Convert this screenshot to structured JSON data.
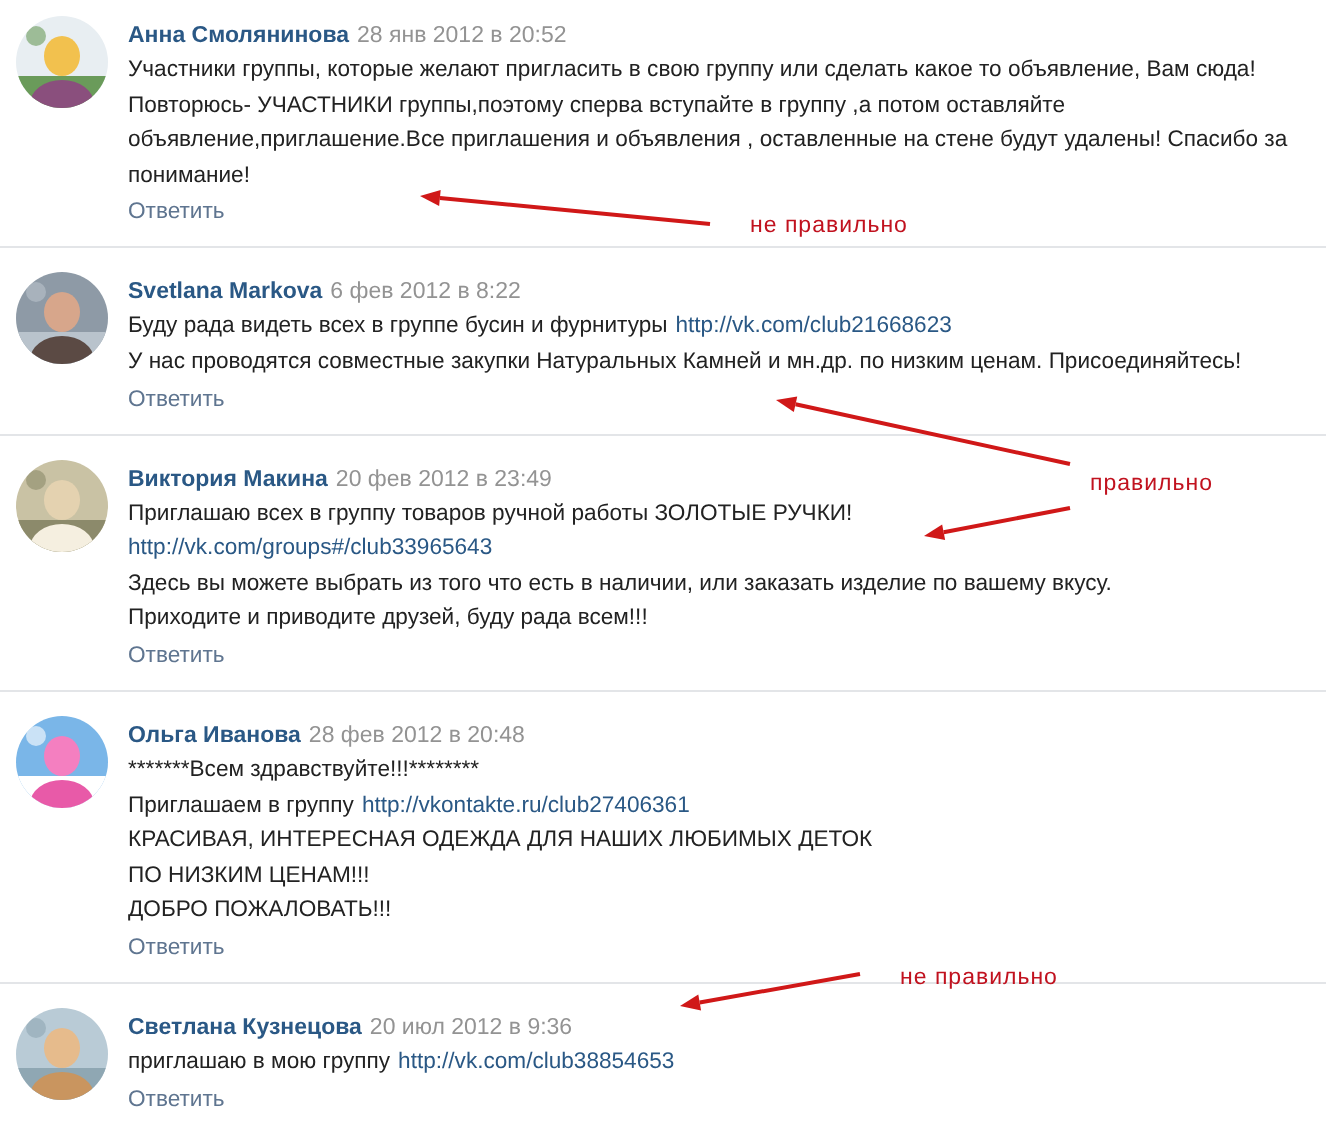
{
  "comments": [
    {
      "author": "Анна Смолянинова",
      "date": "28 янв 2012 в 20:52",
      "avatar": {
        "kind": "picture"
      },
      "lines": [
        [
          {
            "text": "Участники группы, которые желают пригласить в свою группу или сделать какое то объявление, Вам сюда!"
          }
        ],
        [
          {
            "text": "Повторюсь- УЧАСТНИКИ группы,поэтому сперва вступайте в группу ,а потом оставляйте"
          }
        ],
        [
          {
            "text": "объявление,приглашение.Все приглашения и объявления , оставленные на стене будут удалены! Спасибо за"
          }
        ],
        [
          {
            "text": "понимание!"
          }
        ]
      ],
      "reply": "Ответить"
    },
    {
      "author": "Svetlana Markova",
      "date": "6 фев 2012 в 8:22",
      "avatar": {
        "kind": "picture"
      },
      "lines": [
        [
          {
            "text": "Буду рада видеть всех в группе бусин и фурнитуры"
          },
          {
            "text": "http://vk.com/club21668623",
            "link": true
          }
        ],
        [
          {
            "text": "У нас проводятся совместные закупки Натуральных Камней и мн.др. по низким ценам. Присоединяйтесь!"
          }
        ]
      ],
      "reply": "Ответить"
    },
    {
      "author": "Виктория Макина",
      "date": "20 фев 2012 в 23:49",
      "avatar": {
        "kind": "picture"
      },
      "lines": [
        [
          {
            "text": "Приглашаю всех в группу товаров ручной работы ЗОЛОТЫЕ РУЧКИ!"
          }
        ],
        [
          {
            "text": "http://vk.com/groups#/club33965643",
            "link": true
          }
        ],
        [
          {
            "text": "Здесь вы можете выбрать из того что есть в наличии, или заказать изделие по вашему вкусу."
          }
        ],
        [
          {
            "text": "Приходите и приводите друзей, буду рада всем!!!"
          }
        ]
      ],
      "reply": "Ответить"
    },
    {
      "author": "Ольга Иванова",
      "date": "28 фев 2012 в 20:48",
      "avatar": {
        "kind": "picture"
      },
      "lines": [
        [
          {
            "text": "*******Всем здравствуйте!!!********"
          }
        ],
        [
          {
            "text": "Приглашаем в группу"
          },
          {
            "text": "http://vkontakte.ru/club27406361",
            "link": true
          }
        ],
        [
          {
            "text": "КРАСИВАЯ, ИНТЕРЕСНАЯ ОДЕЖДА ДЛЯ НАШИХ ЛЮБИМЫХ ДЕТОК"
          }
        ],
        [
          {
            "text": "ПО НИЗКИМ ЦЕНАМ!!!"
          }
        ],
        [
          {
            "text": "ДОБРО ПОЖАЛОВАТЬ!!!"
          }
        ]
      ],
      "reply": "Ответить"
    },
    {
      "author": "Светлана Кузнецова",
      "date": "20 июл 2012 в 9:36",
      "avatar": {
        "kind": "picture"
      },
      "lines": [
        [
          {
            "text": "приглашаю в мою группу"
          },
          {
            "text": "http://vk.com/club38854653",
            "link": true
          }
        ]
      ],
      "reply": "Ответить"
    }
  ],
  "annotations": [
    {
      "label": "не правильно"
    },
    {
      "label": "правильно"
    },
    {
      "label": "не правильно"
    }
  ]
}
